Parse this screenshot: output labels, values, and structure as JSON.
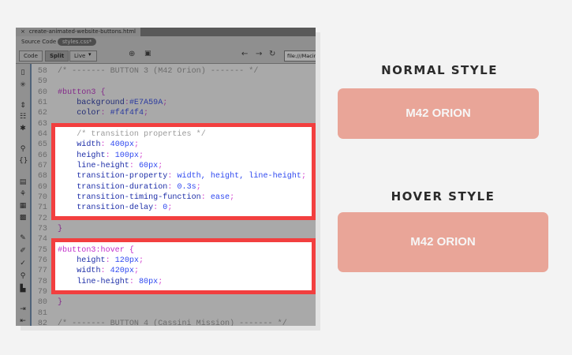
{
  "editor": {
    "file_tab": "create-animated-website-buttons.html",
    "close_icon": "×",
    "source_code_label": "Source Code",
    "related_file": "styles.css*",
    "toolbar": {
      "code": "Code",
      "split": "Split",
      "live": "Live",
      "live_dropdown": "▾",
      "url": "file:///Macir"
    },
    "lines": [
      {
        "n": "58",
        "s": [
          {
            "t": "/* ------- BUTTON 3 (M42 Orion) ------- */",
            "c": "comment"
          }
        ]
      },
      {
        "n": "59",
        "s": []
      },
      {
        "n": "60",
        "s": [
          {
            "t": "#button3 {",
            "c": "selector"
          }
        ]
      },
      {
        "n": "61",
        "s": [
          {
            "t": "    background",
            "c": "prop"
          },
          {
            "t": ":",
            "c": "punct"
          },
          {
            "t": "#E7A59A",
            "c": "value"
          },
          {
            "t": ";",
            "c": "punct"
          }
        ]
      },
      {
        "n": "62",
        "s": [
          {
            "t": "    color",
            "c": "prop"
          },
          {
            "t": ": ",
            "c": "punct"
          },
          {
            "t": "#f4f4f4",
            "c": "value"
          },
          {
            "t": ";",
            "c": "punct"
          }
        ]
      },
      {
        "n": "63",
        "s": []
      },
      {
        "n": "64",
        "s": [
          {
            "t": "    /* transition properties */",
            "c": "comment"
          }
        ]
      },
      {
        "n": "65",
        "s": [
          {
            "t": "    width",
            "c": "prop"
          },
          {
            "t": ": ",
            "c": "punct"
          },
          {
            "t": "400px",
            "c": "value"
          },
          {
            "t": ";",
            "c": "punct"
          }
        ]
      },
      {
        "n": "66",
        "s": [
          {
            "t": "    height",
            "c": "prop"
          },
          {
            "t": ": ",
            "c": "punct"
          },
          {
            "t": "100px",
            "c": "value"
          },
          {
            "t": ";",
            "c": "punct"
          }
        ]
      },
      {
        "n": "67",
        "s": [
          {
            "t": "    line-height",
            "c": "prop"
          },
          {
            "t": ": ",
            "c": "punct"
          },
          {
            "t": "60px",
            "c": "value"
          },
          {
            "t": ";",
            "c": "punct"
          }
        ]
      },
      {
        "n": "68",
        "s": [
          {
            "t": "    transition-property",
            "c": "prop"
          },
          {
            "t": ": ",
            "c": "punct"
          },
          {
            "t": "width, height, line-height",
            "c": "value"
          },
          {
            "t": ";",
            "c": "punct"
          }
        ]
      },
      {
        "n": "69",
        "s": [
          {
            "t": "    transition-duration",
            "c": "prop"
          },
          {
            "t": ": ",
            "c": "punct"
          },
          {
            "t": "0.3s",
            "c": "value"
          },
          {
            "t": ";",
            "c": "punct"
          }
        ]
      },
      {
        "n": "70",
        "s": [
          {
            "t": "    transition-timing-function",
            "c": "prop"
          },
          {
            "t": ": ",
            "c": "punct"
          },
          {
            "t": "ease",
            "c": "value"
          },
          {
            "t": ";",
            "c": "punct"
          }
        ]
      },
      {
        "n": "71",
        "s": [
          {
            "t": "    transition-delay",
            "c": "prop"
          },
          {
            "t": ": ",
            "c": "punct"
          },
          {
            "t": "0",
            "c": "value"
          },
          {
            "t": ";",
            "c": "punct"
          }
        ]
      },
      {
        "n": "72",
        "s": []
      },
      {
        "n": "73",
        "s": [
          {
            "t": "}",
            "c": "selector"
          }
        ]
      },
      {
        "n": "74",
        "s": []
      },
      {
        "n": "75",
        "s": [
          {
            "t": "#button3:hover {",
            "c": "selector"
          }
        ]
      },
      {
        "n": "76",
        "s": [
          {
            "t": "    height",
            "c": "prop"
          },
          {
            "t": ": ",
            "c": "punct"
          },
          {
            "t": "120px",
            "c": "value"
          },
          {
            "t": ";",
            "c": "punct"
          }
        ]
      },
      {
        "n": "77",
        "s": [
          {
            "t": "    width",
            "c": "prop"
          },
          {
            "t": ": ",
            "c": "punct"
          },
          {
            "t": "420px",
            "c": "value"
          },
          {
            "t": ";",
            "c": "punct"
          }
        ]
      },
      {
        "n": "78",
        "s": [
          {
            "t": "    line-height",
            "c": "prop"
          },
          {
            "t": ": ",
            "c": "punct"
          },
          {
            "t": "80px",
            "c": "value"
          },
          {
            "t": ";",
            "c": "punct"
          }
        ]
      },
      {
        "n": "79",
        "s": []
      },
      {
        "n": "80",
        "s": [
          {
            "t": "}",
            "c": "selector"
          }
        ]
      },
      {
        "n": "81",
        "s": []
      },
      {
        "n": "82",
        "s": [
          {
            "t": "/* ------- BUTTON 4 (Cassini Mission) ------- */",
            "c": "comment"
          }
        ]
      }
    ]
  },
  "preview": {
    "normal_heading": "NORMAL STYLE",
    "normal_button": "M42 ORION",
    "hover_heading": "HOVER STYLE",
    "hover_button": "M42 ORION",
    "button_color": "#E7A59A",
    "highlight_color": "#F23F3F"
  }
}
